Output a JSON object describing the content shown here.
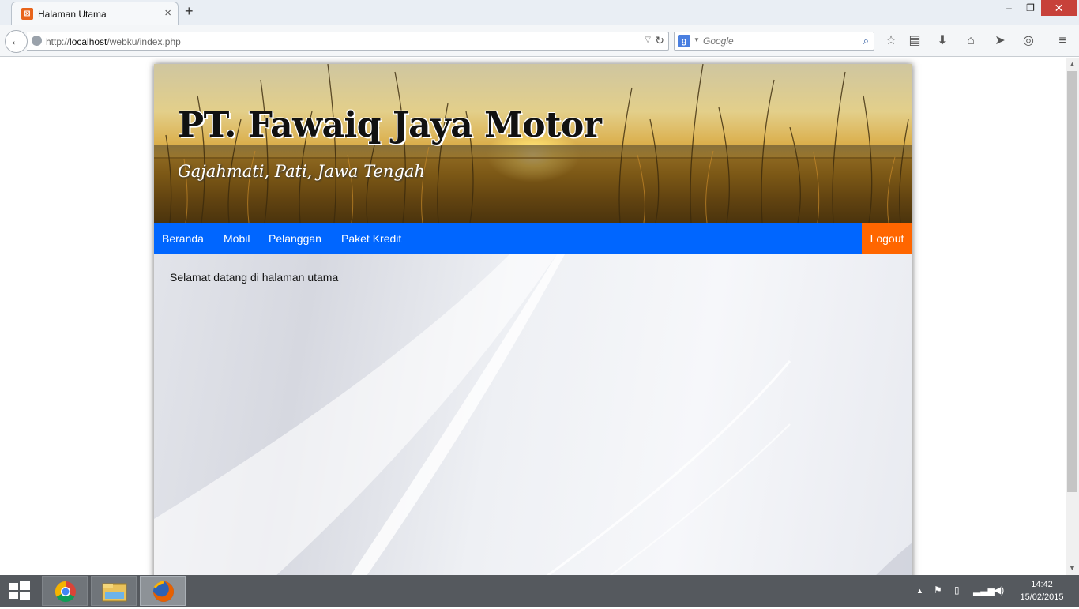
{
  "browser": {
    "tab_title": "Halaman Utama",
    "tab_close": "×",
    "new_tab": "+",
    "url_prefix": "http://",
    "url_host": "localhost",
    "url_path": "/webku/index.php",
    "search_engine_letter": "g",
    "search_placeholder": "Google",
    "window_controls": {
      "minimize": "–",
      "maximize": "❐",
      "close": "✕"
    },
    "toolbar_icons": [
      "star-icon",
      "reading-list-icon",
      "download-icon",
      "home-icon",
      "send-icon",
      "pocket-icon",
      "menu-icon"
    ]
  },
  "site": {
    "title": "PT. Fawaiq Jaya Motor",
    "subtitle": "Gajahmati, Pati, Jawa Tengah",
    "menu": [
      "Beranda",
      "Mobil",
      "Pelanggan",
      "Paket Kredit"
    ],
    "logout": "Logout",
    "welcome": "Selamat datang di halaman utama",
    "colors": {
      "menu": "#0066ff",
      "logout": "#ff6600"
    }
  },
  "taskbar": {
    "apps": [
      "chrome-icon",
      "file-explorer-icon",
      "firefox-icon"
    ],
    "time": "14:42",
    "date": "15/02/2015"
  }
}
